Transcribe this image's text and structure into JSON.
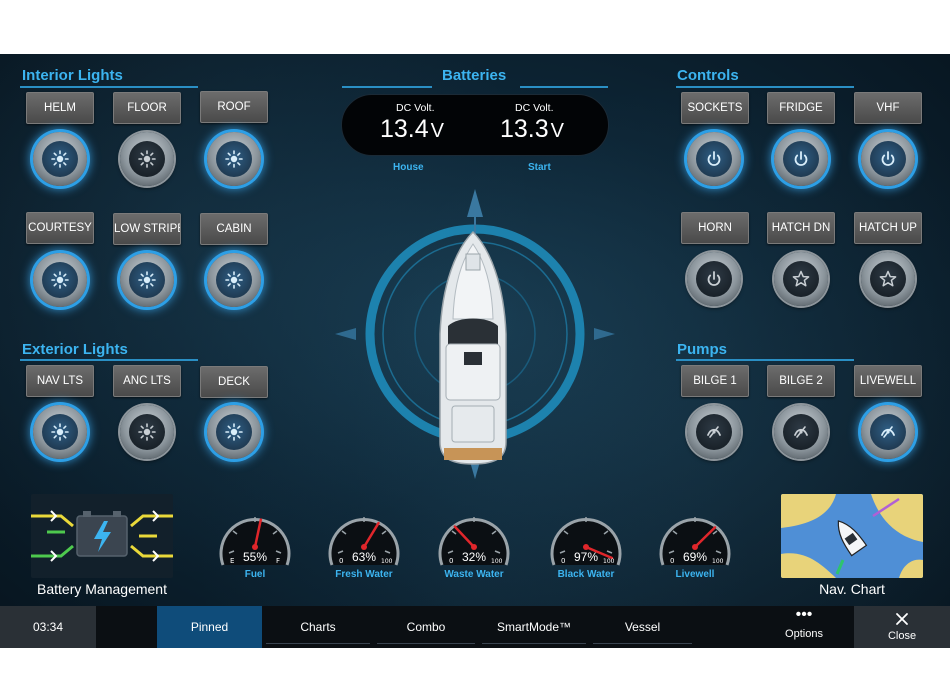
{
  "sections": {
    "interior": "Interior Lights",
    "batteries": "Batteries",
    "controls": "Controls",
    "exterior": "Exterior Lights",
    "pumps": "Pumps"
  },
  "interior_lights": [
    {
      "label": "HELM",
      "state": "on"
    },
    {
      "label": "FLOOR",
      "state": "off"
    },
    {
      "label": "ROOF",
      "state": "on"
    },
    {
      "label": "COURTESY",
      "state": "on"
    },
    {
      "label": "LOW STRIPE",
      "state": "on"
    },
    {
      "label": "CABIN",
      "state": "on"
    }
  ],
  "exterior_lights": [
    {
      "label": "NAV LTS",
      "state": "on"
    },
    {
      "label": "ANC LTS",
      "state": "off"
    },
    {
      "label": "DECK",
      "state": "on"
    }
  ],
  "controls": [
    {
      "label": "SOCKETS",
      "state": "on",
      "icon": "power-icon"
    },
    {
      "label": "FRIDGE",
      "state": "on",
      "icon": "power-icon"
    },
    {
      "label": "VHF",
      "state": "on",
      "icon": "power-icon"
    },
    {
      "label": "HORN",
      "state": "off",
      "icon": "power-icon"
    },
    {
      "label": "HATCH DN",
      "state": "off",
      "icon": "star-icon"
    },
    {
      "label": "HATCH UP",
      "state": "off",
      "icon": "star-icon"
    }
  ],
  "pumps": [
    {
      "label": "BILGE 1",
      "state": "off"
    },
    {
      "label": "BILGE 2",
      "state": "off"
    },
    {
      "label": "LIVEWELL",
      "state": "on"
    }
  ],
  "batteries": {
    "house": {
      "title": "DC Volt.",
      "value": "13.4",
      "unit": "V",
      "name": "House"
    },
    "start": {
      "title": "DC Volt.",
      "value": "13.3",
      "unit": "V",
      "name": "Start"
    }
  },
  "gauges": [
    {
      "label": "Fuel",
      "percent": "55%",
      "value": 55,
      "type": "fuel",
      "left_mark": "E",
      "right_mark": "F"
    },
    {
      "label": "Fresh Water",
      "percent": "63%",
      "value": 63,
      "type": "tank",
      "left_mark": "0",
      "right_mark": "100"
    },
    {
      "label": "Waste Water",
      "percent": "32%",
      "value": 32,
      "type": "tank",
      "left_mark": "0",
      "right_mark": "100"
    },
    {
      "label": "Black Water",
      "percent": "97%",
      "value": 97,
      "type": "tank",
      "left_mark": "0",
      "right_mark": "100"
    },
    {
      "label": "Livewell",
      "percent": "69%",
      "value": 69,
      "type": "tank",
      "left_mark": "0",
      "right_mark": "100"
    }
  ],
  "tiles": {
    "battery_management": "Battery Management",
    "nav_chart": "Nav. Chart"
  },
  "taskbar": {
    "time": "03:34",
    "tabs": [
      "Pinned",
      "Charts",
      "Combo",
      "SmartMode™",
      "Vessel"
    ],
    "active_tab": "Pinned",
    "options": "Options",
    "close": "Close"
  },
  "colors": {
    "accent": "#3cb4f0",
    "active_tab": "#0f4c7a",
    "needle": "#e0262b"
  }
}
